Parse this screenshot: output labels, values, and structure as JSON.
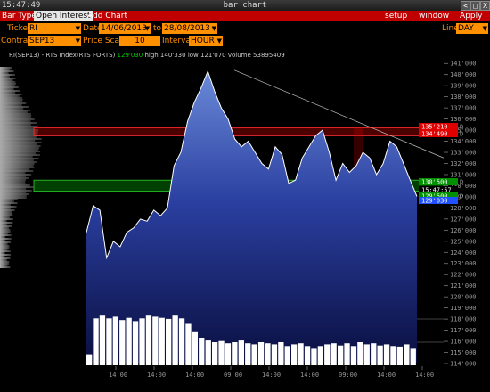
{
  "window": {
    "clock": "15:47:49",
    "title": "bar chart",
    "buttons": [
      "<",
      "□",
      "X"
    ]
  },
  "menu": {
    "bar_type": "Bar Type",
    "open_interest": "Open Interest",
    "add_chart": "Add Chart",
    "setup": "setup",
    "window": "window",
    "apply": "Apply"
  },
  "controls": {
    "ticker_label": "Ticker",
    "ticker": "RI",
    "date_label": "Date",
    "date_from": "14/06/2013",
    "to_label": "to",
    "date_to": "28/08/2013",
    "line_label": "Line",
    "line": "DAY",
    "contract_label": "Contract",
    "contract": "SEP13",
    "price_scale_label": "Price Scale",
    "price_scale": "10",
    "interval_label": "Interval",
    "interval": "HOUR"
  },
  "info": {
    "symbol": "RI(SEP13) - RTS Index(RTS FORTS)",
    "last": "129'030",
    "high": "high 140'330",
    "low": "low 121'070",
    "volume": "volume 53895409"
  },
  "price_axis": [
    "141'000",
    "140'000",
    "139'000",
    "138'000",
    "137'000",
    "136'000",
    "135'000",
    "134'000",
    "133'000",
    "132'000",
    "131'000",
    "130'000",
    "129'000",
    "128'000",
    "127'000",
    "126'000",
    "125'000",
    "124'000",
    "123'000",
    "122'000",
    "121'000",
    "120'000",
    "119'000",
    "118'000",
    "117'000",
    "116'000",
    "115'000",
    "114'000"
  ],
  "price_tags": [
    {
      "text": "135'210",
      "suffix": "D",
      "color": "#e00000"
    },
    {
      "text": "134'490",
      "suffix": "D",
      "color": "#e00000"
    },
    {
      "text": "130'500",
      "suffix": "D",
      "color": "#009000"
    },
    {
      "text": "15:47:57",
      "suffix": "",
      "color": "#000000"
    },
    {
      "text": "129'500",
      "suffix": "D",
      "color": "#009000"
    },
    {
      "text": "129'030",
      "suffix": "",
      "color": "#2050ff"
    }
  ],
  "time_axis": [
    "14:00",
    "14:00",
    "14:00",
    "09:00",
    "14:00",
    "14:00",
    "09:00",
    "14:00",
    "14:00"
  ],
  "chart_data": {
    "type": "area",
    "y_unit": "price",
    "ylim": [
      114000,
      141500
    ],
    "close": [
      125800,
      128200,
      127800,
      123500,
      125000,
      124500,
      125800,
      126200,
      127000,
      126800,
      127800,
      127300,
      128000,
      131800,
      133000,
      135800,
      137500,
      138800,
      140300,
      138500,
      137000,
      136000,
      134200,
      133500,
      134000,
      133000,
      132000,
      131500,
      133500,
      132800,
      130200,
      130500,
      132500,
      133500,
      134500,
      135000,
      133000,
      130500,
      132000,
      131200,
      131800,
      133000,
      132500,
      131000,
      132000,
      134000,
      133500,
      132000,
      130500,
      129030
    ],
    "volume": [
      0.2,
      0.85,
      0.9,
      0.85,
      0.88,
      0.82,
      0.86,
      0.8,
      0.85,
      0.9,
      0.88,
      0.86,
      0.84,
      0.9,
      0.85,
      0.75,
      0.6,
      0.5,
      0.45,
      0.42,
      0.44,
      0.4,
      0.42,
      0.45,
      0.4,
      0.38,
      0.42,
      0.4,
      0.38,
      0.42,
      0.35,
      0.38,
      0.4,
      0.35,
      0.3,
      0.35,
      0.38,
      0.4,
      0.36,
      0.4,
      0.35,
      0.42,
      0.38,
      0.4,
      0.36,
      0.38,
      0.35,
      0.34,
      0.38,
      0.3
    ]
  }
}
